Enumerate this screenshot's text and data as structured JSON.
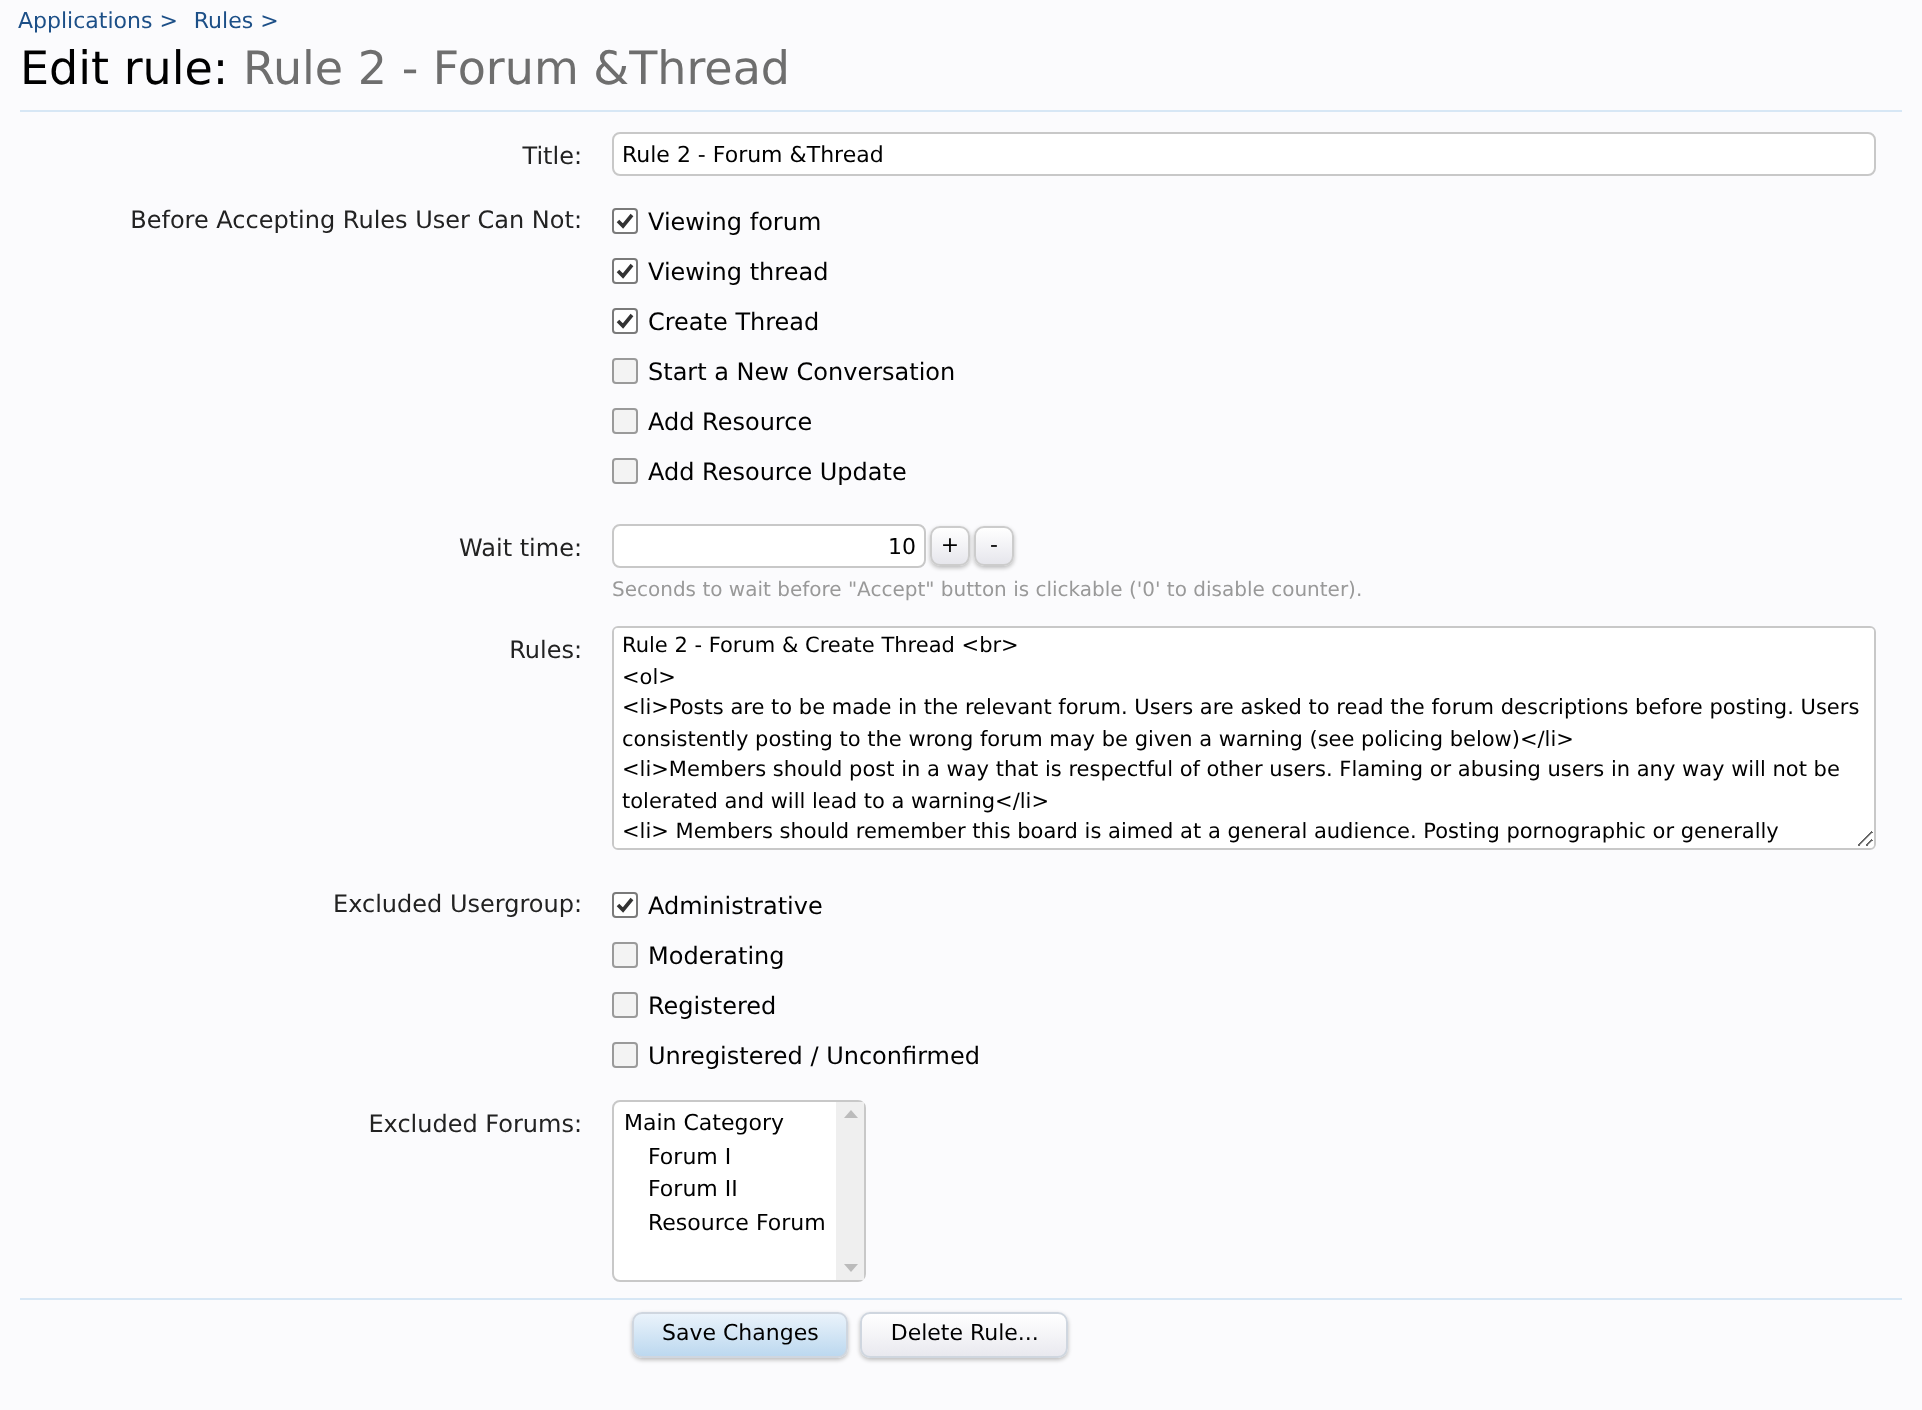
{
  "breadcrumb": [
    "Applications >",
    "Rules >"
  ],
  "heading": {
    "prefix": "Edit rule:",
    "name": "Rule 2 - Forum &Thread"
  },
  "title_field": {
    "label": "Title:",
    "value": "Rule 2 - Forum &Thread"
  },
  "restrictions": {
    "label": "Before Accepting Rules User Can Not:",
    "options": [
      {
        "label": "Viewing forum",
        "checked": true
      },
      {
        "label": "Viewing thread",
        "checked": true
      },
      {
        "label": "Create Thread",
        "checked": true
      },
      {
        "label": "Start a New Conversation",
        "checked": false
      },
      {
        "label": "Add Resource",
        "checked": false
      },
      {
        "label": "Add Resource Update",
        "checked": false
      }
    ]
  },
  "wait_time": {
    "label": "Wait time:",
    "value": "10",
    "buttons": [
      "+",
      "-"
    ],
    "hint": "Seconds to wait before \"Accept\" button is clickable ('0' to disable counter)."
  },
  "rules": {
    "label": "Rules:",
    "lines": [
      "Rule 2 - Forum & Create Thread <br>",
      "<ol>",
      "<li>Posts are to be made in the relevant forum. Users are asked to read the forum descriptions before posting. Users consistently posting to the wrong forum may be given a warning (see policing below)</li>",
      "<li>Members should post in a way that is respectful of other users. Flaming or abusing users in any way will not be tolerated and will lead to a warning</li>",
      "<li> Members should remember this board is aimed at a general audience. Posting pornographic or generally"
    ]
  },
  "excluded_usergroups": {
    "label": "Excluded Usergroup:",
    "options": [
      {
        "label": "Administrative",
        "checked": true
      },
      {
        "label": "Moderating",
        "checked": false
      },
      {
        "label": "Registered",
        "checked": false
      },
      {
        "label": "Unregistered / Unconfirmed",
        "checked": false
      }
    ]
  },
  "excluded_forums": {
    "label": "Excluded Forums:",
    "items": [
      {
        "label": "Main Category",
        "children": [
          {
            "label": "Forum I"
          },
          {
            "label": "Forum II"
          },
          {
            "label": "Resource Forum"
          }
        ]
      }
    ]
  },
  "buttons": [
    {
      "label": "Save Changes",
      "kind": "primary"
    },
    {
      "label": "Delete Rule...",
      "kind": "secondary"
    }
  ]
}
